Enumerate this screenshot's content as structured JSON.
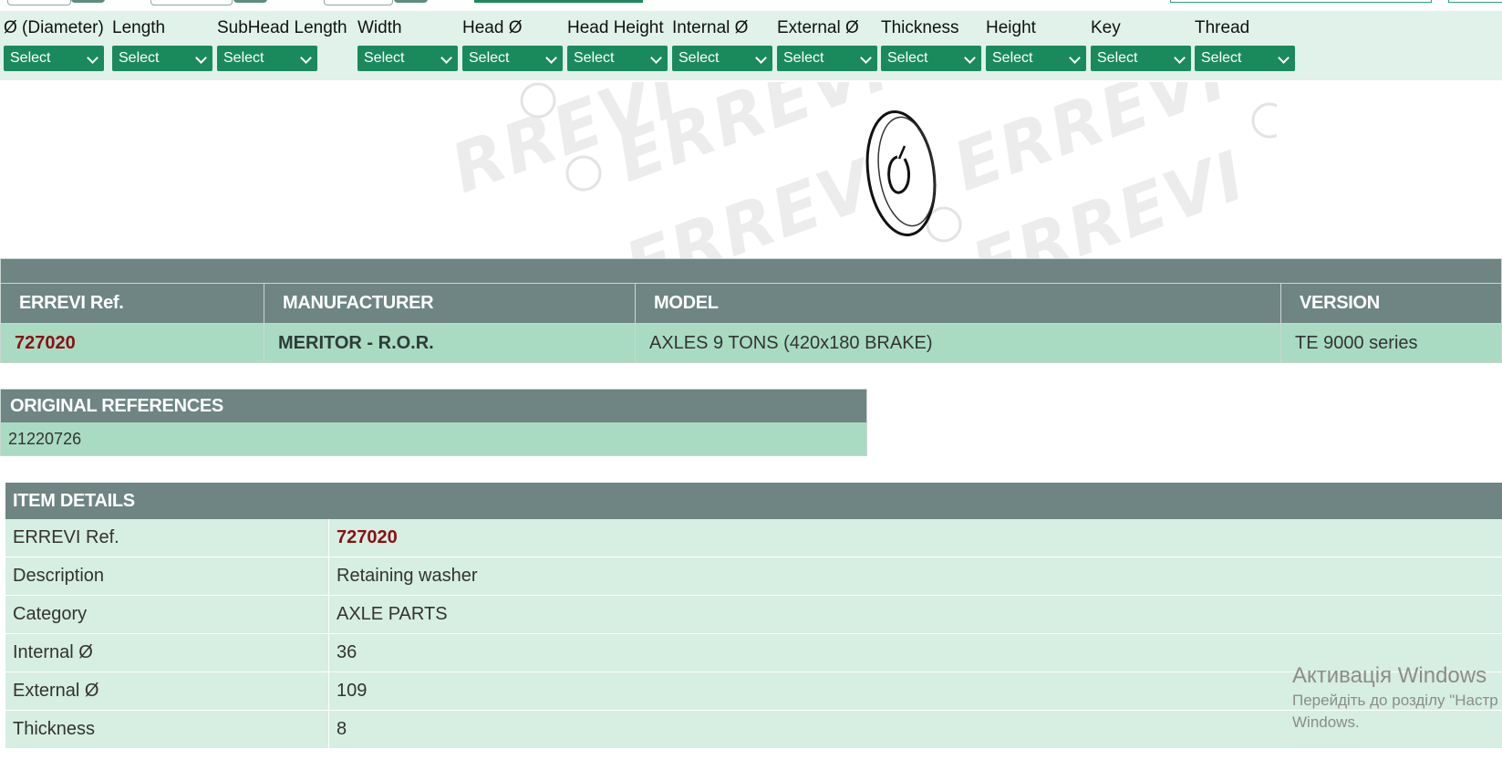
{
  "filters": [
    {
      "label": "Ø (Diameter)",
      "value": "Select"
    },
    {
      "label": "Length",
      "value": "Select"
    },
    {
      "label": "SubHead Length",
      "value": "Select"
    },
    {
      "label": "Width",
      "value": "Select"
    },
    {
      "label": "Head Ø",
      "value": "Select"
    },
    {
      "label": "Head Height",
      "value": "Select"
    },
    {
      "label": "Internal Ø",
      "value": "Select"
    },
    {
      "label": "External Ø",
      "value": "Select"
    },
    {
      "label": "Thickness",
      "value": "Select"
    },
    {
      "label": "Height",
      "value": "Select"
    },
    {
      "label": "Key",
      "value": "Select"
    },
    {
      "label": "Thread",
      "value": "Select"
    }
  ],
  "image": {
    "watermark": "ERREVI"
  },
  "references": {
    "headers": [
      "ERREVI Ref.",
      "MANUFACTURER",
      "MODEL",
      "VERSION"
    ],
    "rows": [
      [
        "727020",
        "MERITOR - R.O.R.",
        "AXLES 9 TONS (420x180 BRAKE)",
        "TE 9000 series"
      ]
    ]
  },
  "original_references": {
    "title": "ORIGINAL REFERENCES",
    "items": [
      "21220726"
    ]
  },
  "item_details": {
    "title": "ITEM DETAILS",
    "rows": [
      {
        "key": "ERREVI Ref.",
        "value": "727020"
      },
      {
        "key": "Description",
        "value": "Retaining washer"
      },
      {
        "key": "Category",
        "value": "AXLE PARTS"
      },
      {
        "key": "Internal Ø",
        "value": "36"
      },
      {
        "key": "External Ø",
        "value": "109"
      },
      {
        "key": "Thickness",
        "value": "8"
      }
    ]
  },
  "windows_activation": {
    "line1": "Активація Windows",
    "line2": "Перейдіть до розділу \"Настр",
    "line3": "Windows."
  },
  "colors": {
    "select_bg": "#1a8a5c",
    "header_bg": "#6e8583",
    "row_bg": "#a9dbc2",
    "detail_bg": "#d7eee2",
    "code_text": "#8b0f12"
  }
}
